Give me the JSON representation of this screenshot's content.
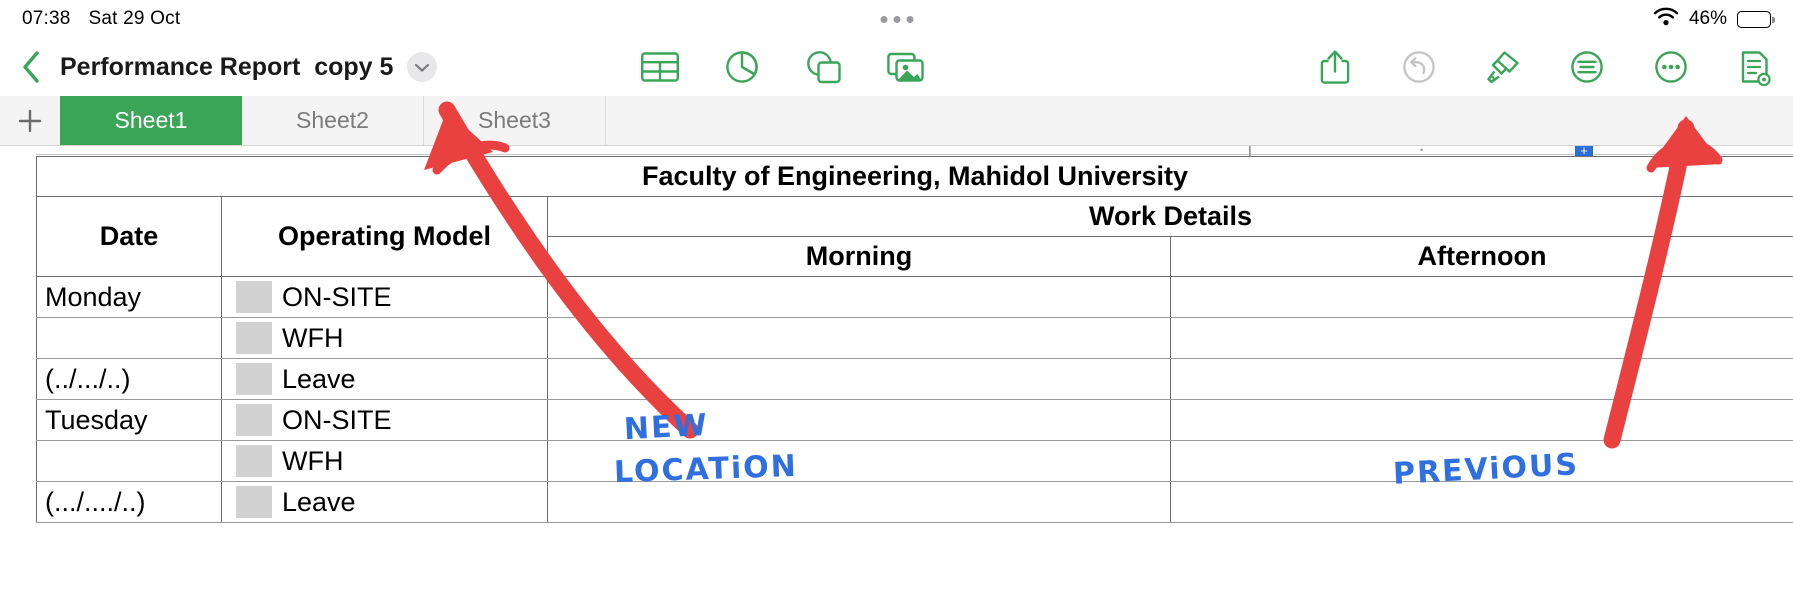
{
  "status_bar": {
    "time": "07:38",
    "date": "Sat 29 Oct",
    "battery_percent": "46%",
    "wifi_icon": "wifi-icon",
    "battery_icon": "battery-icon",
    "center_dots": "more-dots-indicator"
  },
  "toolbar": {
    "back_icon": "back-chevron-icon",
    "document_title": "Performance Report  copy 5",
    "title_chevron_icon": "chevron-down-icon",
    "center_icons": [
      {
        "name": "insert-table-icon",
        "label": "Table"
      },
      {
        "name": "insert-chart-icon",
        "label": "Chart"
      },
      {
        "name": "insert-shape-icon",
        "label": "Shape"
      },
      {
        "name": "insert-media-icon",
        "label": "Media"
      }
    ],
    "right_icons": [
      {
        "name": "share-icon",
        "label": "Share",
        "enabled": true
      },
      {
        "name": "undo-icon",
        "label": "Undo",
        "enabled": false
      },
      {
        "name": "format-brush-icon",
        "label": "Format",
        "enabled": true
      },
      {
        "name": "insert-text-icon",
        "label": "Insert",
        "enabled": true
      },
      {
        "name": "more-options-icon",
        "label": "More",
        "enabled": true
      },
      {
        "name": "document-options-icon",
        "label": "Document Options",
        "enabled": true
      }
    ]
  },
  "sheet_bar": {
    "add_label": "+",
    "tabs": [
      {
        "label": "Sheet1",
        "active": true
      },
      {
        "label": "Sheet2",
        "active": false
      },
      {
        "label": "Sheet3",
        "active": false
      }
    ]
  },
  "spreadsheet": {
    "title": "Faculty of Engineering, Mahidol University",
    "headers": {
      "date": "Date",
      "operating_model": "Operating Model",
      "work_details": "Work Details",
      "morning": "Morning",
      "afternoon": "Afternoon"
    },
    "rows": [
      {
        "date": "Monday",
        "model": "ON-SITE",
        "morning": "",
        "afternoon": ""
      },
      {
        "date": "",
        "model": "WFH",
        "morning": "",
        "afternoon": ""
      },
      {
        "date": "(../.../..)",
        "model": "Leave",
        "morning": "",
        "afternoon": ""
      },
      {
        "date": "Tuesday",
        "model": "ON-SITE",
        "morning": "",
        "afternoon": ""
      },
      {
        "date": "",
        "model": "WFH",
        "morning": "",
        "afternoon": ""
      },
      {
        "date": "(.../..../..)",
        "model": "Leave",
        "morning": "",
        "afternoon": ""
      }
    ],
    "table_handle_label": "+"
  },
  "annotations": {
    "new_text": "NEW",
    "location_text": "LOCATiON",
    "previous_text": "PREViOUS",
    "arrow_color": "#e8413f",
    "ink_color": "#2f6fe0"
  },
  "colors": {
    "accent_green": "#3aa557",
    "header_peach": "#fae6d7",
    "checkbox_gray": "#d2d2d2",
    "disabled_gray": "#c4c4c4"
  }
}
